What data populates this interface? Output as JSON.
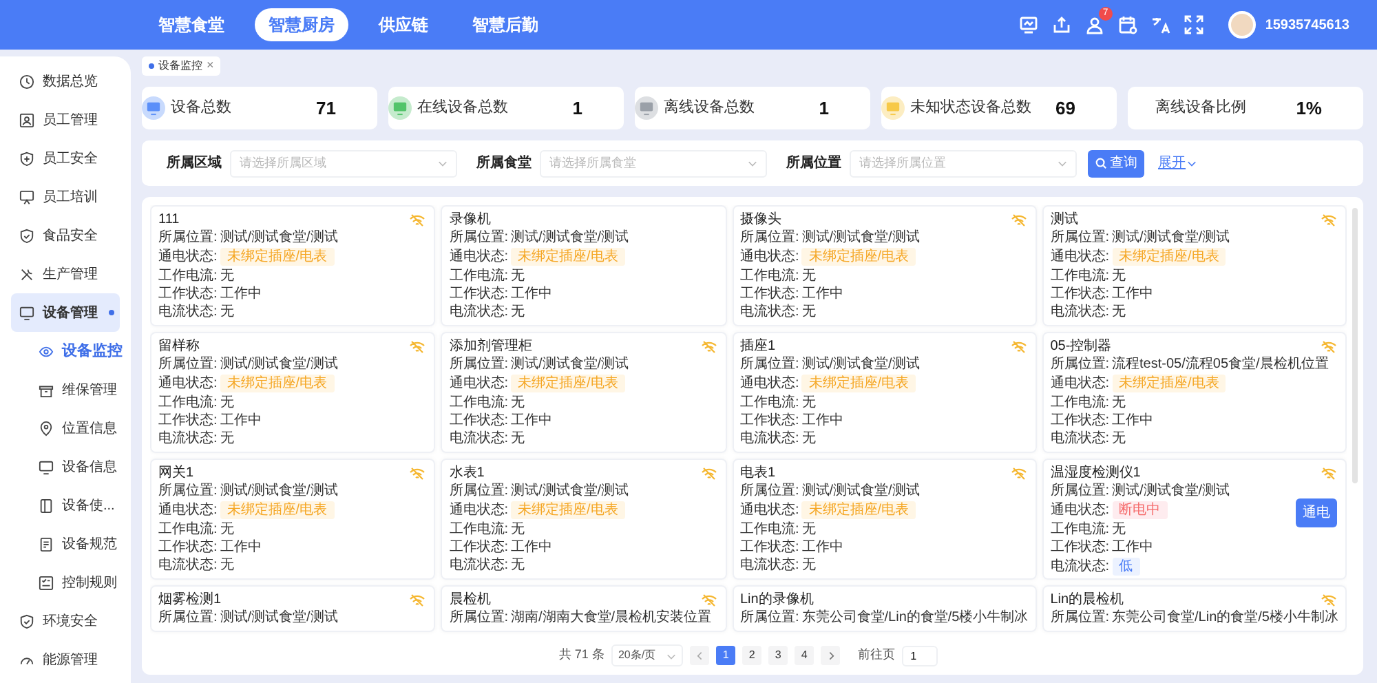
{
  "nav": {
    "tabs": [
      {
        "label": "智慧食堂",
        "selected": false
      },
      {
        "label": "智慧厨房",
        "selected": true
      },
      {
        "label": "供应链",
        "selected": false
      },
      {
        "label": "智慧后勤",
        "selected": false
      }
    ],
    "notification_badge": "7",
    "user": "15935745613"
  },
  "sidebar": {
    "items": [
      {
        "label": "数据总览",
        "selected": false,
        "expanded": false
      },
      {
        "label": "员工管理",
        "selected": false,
        "expanded": false
      },
      {
        "label": "员工安全",
        "selected": false,
        "expanded": false
      },
      {
        "label": "员工培训",
        "selected": false,
        "expanded": false
      },
      {
        "label": "食品安全",
        "selected": false,
        "expanded": false
      },
      {
        "label": "生产管理",
        "selected": false,
        "expanded": false
      },
      {
        "label": "设备管理",
        "selected": true,
        "expanded": true,
        "children": [
          {
            "label": "设备监控",
            "selected": true
          },
          {
            "label": "维保管理",
            "selected": false
          },
          {
            "label": "位置信息",
            "selected": false
          },
          {
            "label": "设备信息",
            "selected": false
          },
          {
            "label": "设备使...",
            "selected": false
          },
          {
            "label": "设备规范",
            "selected": false
          },
          {
            "label": "控制规则",
            "selected": false
          }
        ]
      },
      {
        "label": "环境安全",
        "selected": false,
        "expanded": false
      },
      {
        "label": "能源管理",
        "selected": false,
        "expanded": false
      }
    ]
  },
  "page_tabs": [
    {
      "label": "设备监控",
      "selected": true,
      "close": "×"
    }
  ],
  "stats": [
    {
      "label": "设备总数",
      "value": "71",
      "color": "#5b8ff9"
    },
    {
      "label": "在线设备总数",
      "value": "1",
      "color": "#52c46a"
    },
    {
      "label": "离线设备总数",
      "value": "1",
      "color": "#9aa0a8"
    },
    {
      "label": "未知状态设备总数",
      "value": "69",
      "color": "#f7c948"
    },
    {
      "label": "离线设备比例",
      "value": "1%"
    }
  ],
  "filters": [
    {
      "label": "所属区域",
      "placeholder": "请选择所属区域"
    },
    {
      "label": "所属食堂",
      "placeholder": "请选择所属食堂"
    },
    {
      "label": "所属位置",
      "placeholder": "请选择所属位置"
    }
  ],
  "search_button": "查询",
  "expand_link": "展开",
  "devices": [
    {
      "name": "111",
      "wifi": true,
      "fields": [
        {
          "label": "所属位置:",
          "value": "测试/测试食堂/测试",
          "kind": "text"
        },
        {
          "label": "通电状态:",
          "value": "未绑定插座/电表",
          "kind": "warning"
        },
        {
          "label": "工作电流:",
          "value": "无",
          "kind": "text"
        },
        {
          "label": "工作状态:",
          "value": "工作中",
          "kind": "text"
        },
        {
          "label": "电流状态:",
          "value": "无",
          "kind": "text"
        }
      ]
    },
    {
      "name": "录像机",
      "wifi": false,
      "fields": [
        {
          "label": "所属位置:",
          "value": "测试/测试食堂/测试",
          "kind": "text"
        },
        {
          "label": "通电状态:",
          "value": "未绑定插座/电表",
          "kind": "warning"
        },
        {
          "label": "工作电流:",
          "value": "无",
          "kind": "text"
        },
        {
          "label": "工作状态:",
          "value": "工作中",
          "kind": "text"
        },
        {
          "label": "电流状态:",
          "value": "无",
          "kind": "text"
        }
      ]
    },
    {
      "name": "摄像头",
      "wifi": true,
      "fields": [
        {
          "label": "所属位置:",
          "value": "测试/测试食堂/测试",
          "kind": "text"
        },
        {
          "label": "通电状态:",
          "value": "未绑定插座/电表",
          "kind": "warning"
        },
        {
          "label": "工作电流:",
          "value": "无",
          "kind": "text"
        },
        {
          "label": "工作状态:",
          "value": "工作中",
          "kind": "text"
        },
        {
          "label": "电流状态:",
          "value": "无",
          "kind": "text"
        }
      ]
    },
    {
      "name": "测试",
      "wifi": true,
      "fields": [
        {
          "label": "所属位置:",
          "value": "测试/测试食堂/测试",
          "kind": "text"
        },
        {
          "label": "通电状态:",
          "value": "未绑定插座/电表",
          "kind": "warning"
        },
        {
          "label": "工作电流:",
          "value": "无",
          "kind": "text"
        },
        {
          "label": "工作状态:",
          "value": "工作中",
          "kind": "text"
        },
        {
          "label": "电流状态:",
          "value": "无",
          "kind": "text"
        }
      ]
    },
    {
      "name": "留样称",
      "wifi": true,
      "fields": [
        {
          "label": "所属位置:",
          "value": "测试/测试食堂/测试",
          "kind": "text"
        },
        {
          "label": "通电状态:",
          "value": "未绑定插座/电表",
          "kind": "warning"
        },
        {
          "label": "工作电流:",
          "value": "无",
          "kind": "text"
        },
        {
          "label": "工作状态:",
          "value": "工作中",
          "kind": "text"
        },
        {
          "label": "电流状态:",
          "value": "无",
          "kind": "text"
        }
      ]
    },
    {
      "name": "添加剂管理柜",
      "wifi": true,
      "fields": [
        {
          "label": "所属位置:",
          "value": "测试/测试食堂/测试",
          "kind": "text"
        },
        {
          "label": "通电状态:",
          "value": "未绑定插座/电表",
          "kind": "warning"
        },
        {
          "label": "工作电流:",
          "value": "无",
          "kind": "text"
        },
        {
          "label": "工作状态:",
          "value": "工作中",
          "kind": "text"
        },
        {
          "label": "电流状态:",
          "value": "无",
          "kind": "text"
        }
      ]
    },
    {
      "name": "插座1",
      "wifi": true,
      "fields": [
        {
          "label": "所属位置:",
          "value": "测试/测试食堂/测试",
          "kind": "text"
        },
        {
          "label": "通电状态:",
          "value": "未绑定插座/电表",
          "kind": "warning"
        },
        {
          "label": "工作电流:",
          "value": "无",
          "kind": "text"
        },
        {
          "label": "工作状态:",
          "value": "工作中",
          "kind": "text"
        },
        {
          "label": "电流状态:",
          "value": "无",
          "kind": "text"
        }
      ]
    },
    {
      "name": "05-控制器",
      "wifi": true,
      "fields": [
        {
          "label": "所属位置:",
          "value": "流程test-05/流程05食堂/晨检机位置",
          "kind": "text"
        },
        {
          "label": "通电状态:",
          "value": "未绑定插座/电表",
          "kind": "warning"
        },
        {
          "label": "工作电流:",
          "value": "无",
          "kind": "text"
        },
        {
          "label": "工作状态:",
          "value": "工作中",
          "kind": "text"
        },
        {
          "label": "电流状态:",
          "value": "无",
          "kind": "text"
        }
      ]
    },
    {
      "name": "网关1",
      "wifi": true,
      "fields": [
        {
          "label": "所属位置:",
          "value": "测试/测试食堂/测试",
          "kind": "text"
        },
        {
          "label": "通电状态:",
          "value": "未绑定插座/电表",
          "kind": "warning"
        },
        {
          "label": "工作电流:",
          "value": "无",
          "kind": "text"
        },
        {
          "label": "工作状态:",
          "value": "工作中",
          "kind": "text"
        },
        {
          "label": "电流状态:",
          "value": "无",
          "kind": "text"
        }
      ]
    },
    {
      "name": "水表1",
      "wifi": true,
      "fields": [
        {
          "label": "所属位置:",
          "value": "测试/测试食堂/测试",
          "kind": "text"
        },
        {
          "label": "通电状态:",
          "value": "未绑定插座/电表",
          "kind": "warning"
        },
        {
          "label": "工作电流:",
          "value": "无",
          "kind": "text"
        },
        {
          "label": "工作状态:",
          "value": "工作中",
          "kind": "text"
        },
        {
          "label": "电流状态:",
          "value": "无",
          "kind": "text"
        }
      ]
    },
    {
      "name": "电表1",
      "wifi": true,
      "fields": [
        {
          "label": "所属位置:",
          "value": "测试/测试食堂/测试",
          "kind": "text"
        },
        {
          "label": "通电状态:",
          "value": "未绑定插座/电表",
          "kind": "warning"
        },
        {
          "label": "工作电流:",
          "value": "无",
          "kind": "text"
        },
        {
          "label": "工作状态:",
          "value": "工作中",
          "kind": "text"
        },
        {
          "label": "电流状态:",
          "value": "无",
          "kind": "text"
        }
      ]
    },
    {
      "name": "温湿度检测仪1",
      "wifi": true,
      "action": "通电",
      "fields": [
        {
          "label": "所属位置:",
          "value": "测试/测试食堂/测试",
          "kind": "text"
        },
        {
          "label": "通电状态:",
          "value": "断电中",
          "kind": "danger"
        },
        {
          "label": "工作电流:",
          "value": "无",
          "kind": "text"
        },
        {
          "label": "工作状态:",
          "value": "工作中",
          "kind": "text"
        },
        {
          "label": "电流状态:",
          "value": "低",
          "kind": "info"
        }
      ]
    },
    {
      "name": "烟雾检测1",
      "wifi": true,
      "fields": [
        {
          "label": "所属位置:",
          "value": "测试/测试食堂/测试",
          "kind": "text"
        }
      ]
    },
    {
      "name": "晨检机",
      "wifi": true,
      "fields": [
        {
          "label": "所属位置:",
          "value": "湖南/湖南大食堂/晨检机安装位置",
          "kind": "text"
        }
      ]
    },
    {
      "name": "Lin的录像机",
      "wifi": false,
      "fields": [
        {
          "label": "所属位置:",
          "value": "东莞公司食堂/Lin的食堂/5楼小牛制冰",
          "kind": "text"
        }
      ]
    },
    {
      "name": "Lin的晨检机",
      "wifi": true,
      "fields": [
        {
          "label": "所属位置:",
          "value": "东莞公司食堂/Lin的食堂/5楼小牛制冰",
          "kind": "text"
        }
      ]
    }
  ],
  "pagination": {
    "total": "共 71 条",
    "page_size": "20条/页",
    "pages": [
      {
        "label": "1",
        "selected": true
      },
      {
        "label": "2",
        "selected": false
      },
      {
        "label": "3",
        "selected": false
      },
      {
        "label": "4",
        "selected": false
      }
    ],
    "goto_label": "前往页",
    "goto_value": "1"
  }
}
